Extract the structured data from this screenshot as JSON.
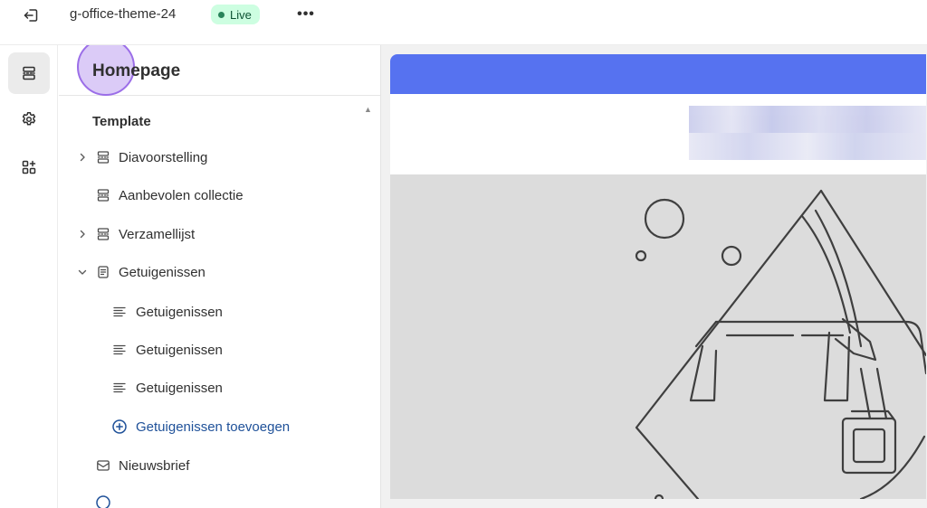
{
  "topbar": {
    "theme_name": "g-office-theme-24",
    "status": "Live",
    "more_label": "•••"
  },
  "rail": {
    "items": [
      {
        "id": "sections",
        "active": true
      },
      {
        "id": "settings",
        "active": false
      },
      {
        "id": "apps",
        "active": false
      }
    ]
  },
  "panel": {
    "title": "Homepage",
    "group_label": "Template",
    "items": [
      {
        "label": "Diavoorstelling",
        "icon": "section-icon",
        "expand": "collapsed"
      },
      {
        "label": "Aanbevolen collectie",
        "icon": "section-icon",
        "expand": "none"
      },
      {
        "label": "Verzamellijst",
        "icon": "section-icon",
        "expand": "collapsed"
      },
      {
        "label": "Getuigenissen",
        "icon": "document-icon",
        "expand": "expanded"
      },
      {
        "label": "Getuigenissen",
        "icon": "text-block-icon",
        "expand": "child"
      },
      {
        "label": "Getuigenissen",
        "icon": "text-block-icon",
        "expand": "child"
      },
      {
        "label": "Getuigenissen",
        "icon": "text-block-icon",
        "expand": "child"
      },
      {
        "label": "Getuigenissen toevoegen",
        "icon": "add-circle-icon",
        "expand": "child-link"
      },
      {
        "label": "Nieuwsbrief",
        "icon": "email-icon",
        "expand": "none"
      }
    ]
  },
  "colors": {
    "announcement_bar": "#5672f0",
    "live_badge_bg": "#cdfee1",
    "live_dot": "#29845a",
    "link": "#1f5199",
    "hero_bg": "#dcdcdc"
  }
}
